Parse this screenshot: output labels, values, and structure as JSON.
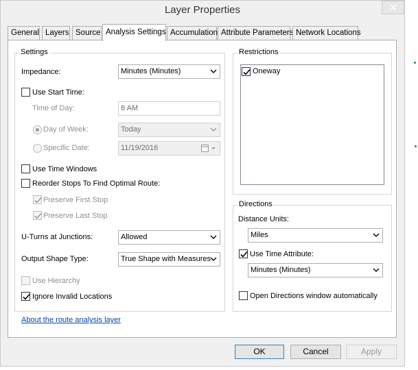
{
  "window": {
    "title": "Layer Properties"
  },
  "tabs": [
    {
      "label": "General"
    },
    {
      "label": "Layers"
    },
    {
      "label": "Source"
    },
    {
      "label": "Analysis Settings"
    },
    {
      "label": "Accumulation"
    },
    {
      "label": "Attribute Parameters"
    },
    {
      "label": "Network Locations"
    }
  ],
  "active_tab": "Analysis Settings",
  "settings": {
    "group_title": "Settings",
    "impedance_label": "Impedance:",
    "impedance_value": "Minutes (Minutes)",
    "use_start_time": {
      "label": "Use Start Time:",
      "checked": false
    },
    "time_of_day_label": "Time of Day:",
    "time_of_day_value": "8 AM",
    "day_of_week": {
      "label": "Day of Week:",
      "value": "Today",
      "selected": true
    },
    "specific_date": {
      "label": "Specific Date:",
      "value": "11/19/2016",
      "selected": false
    },
    "use_time_windows": {
      "label": "Use Time Windows",
      "checked": false
    },
    "reorder_stops": {
      "label": "Reorder Stops To Find Optimal Route:",
      "checked": false
    },
    "preserve_first": {
      "label": "Preserve First Stop",
      "checked": true,
      "enabled": false
    },
    "preserve_last": {
      "label": "Preserve Last Stop",
      "checked": true,
      "enabled": false
    },
    "uturns_label": "U-Turns at Junctions:",
    "uturns_value": "Allowed",
    "output_shape_label": "Output Shape Type:",
    "output_shape_value": "True Shape with Measures",
    "use_hierarchy": {
      "label": "Use Hierarchy",
      "checked": false,
      "enabled": false
    },
    "ignore_invalid": {
      "label": "Ignore Invalid Locations",
      "checked": true
    }
  },
  "restrictions": {
    "group_title": "Restrictions",
    "items": [
      {
        "label": "Oneway",
        "checked": true
      }
    ]
  },
  "directions": {
    "group_title": "Directions",
    "distance_units_label": "Distance Units:",
    "distance_units_value": "Miles",
    "use_time_attribute": {
      "label": "Use Time Attribute:",
      "checked": true
    },
    "time_attribute_value": "Minutes (Minutes)",
    "open_directions": {
      "label": "Open Directions window automatically",
      "checked": false
    }
  },
  "about_link": "About the route analysis layer",
  "buttons": {
    "ok": "OK",
    "cancel": "Cancel",
    "apply": "Apply"
  },
  "colors": {
    "link": "#0645ad",
    "default_button_border": "#3c7fb1",
    "background_marker": "#2a8a2a"
  }
}
